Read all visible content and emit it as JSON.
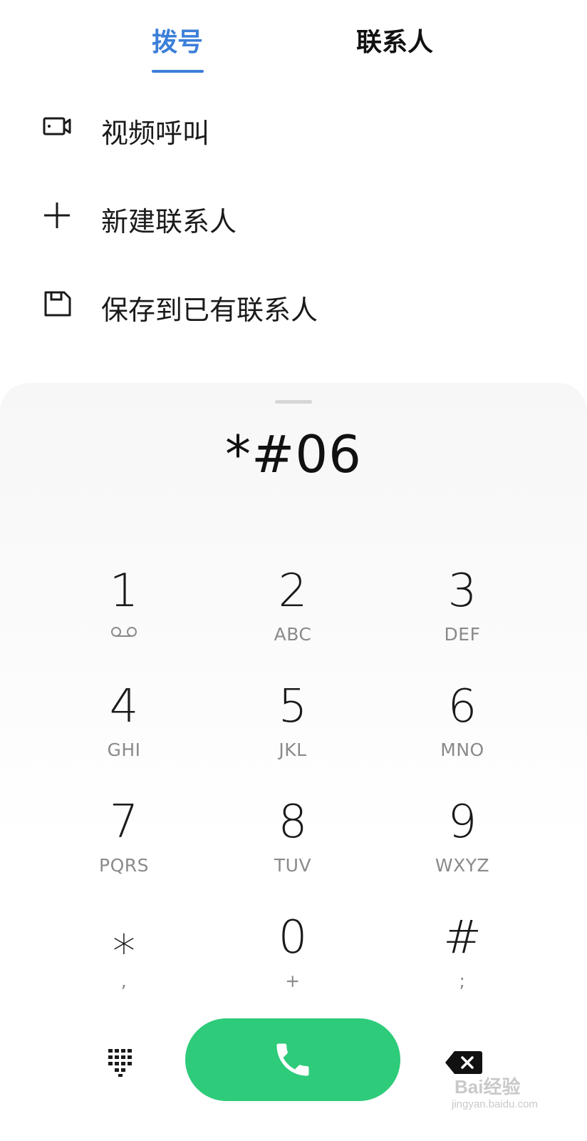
{
  "tabs": {
    "dial": "拨号",
    "contacts": "联系人",
    "active": "dial",
    "accent": "#3b7fd9"
  },
  "actions": [
    {
      "label": "视频呼叫",
      "icon": "video-call-icon"
    },
    {
      "label": "新建联系人",
      "icon": "plus-icon"
    },
    {
      "label": "保存到已有联系人",
      "icon": "save-icon"
    }
  ],
  "display": {
    "number": "*#06"
  },
  "keypad": [
    {
      "digit": "1",
      "sub": "",
      "icon": "voicemail-icon"
    },
    {
      "digit": "2",
      "sub": "ABC"
    },
    {
      "digit": "3",
      "sub": "DEF"
    },
    {
      "digit": "4",
      "sub": "GHI"
    },
    {
      "digit": "5",
      "sub": "JKL"
    },
    {
      "digit": "6",
      "sub": "MNO"
    },
    {
      "digit": "7",
      "sub": "PQRS"
    },
    {
      "digit": "8",
      "sub": "TUV"
    },
    {
      "digit": "9",
      "sub": "WXYZ"
    },
    {
      "digit": "⁎",
      "sub": ","
    },
    {
      "digit": "0",
      "sub": "+"
    },
    {
      "digit": "#",
      "sub": ";"
    }
  ],
  "controls": {
    "dialpad_icon": "dialpad-icon",
    "call_icon": "phone-icon",
    "call_color": "#2ecb7a",
    "backspace_icon": "backspace-icon"
  },
  "watermark": {
    "brand": "Bai经验",
    "url": "jingyan.baidu.com"
  }
}
